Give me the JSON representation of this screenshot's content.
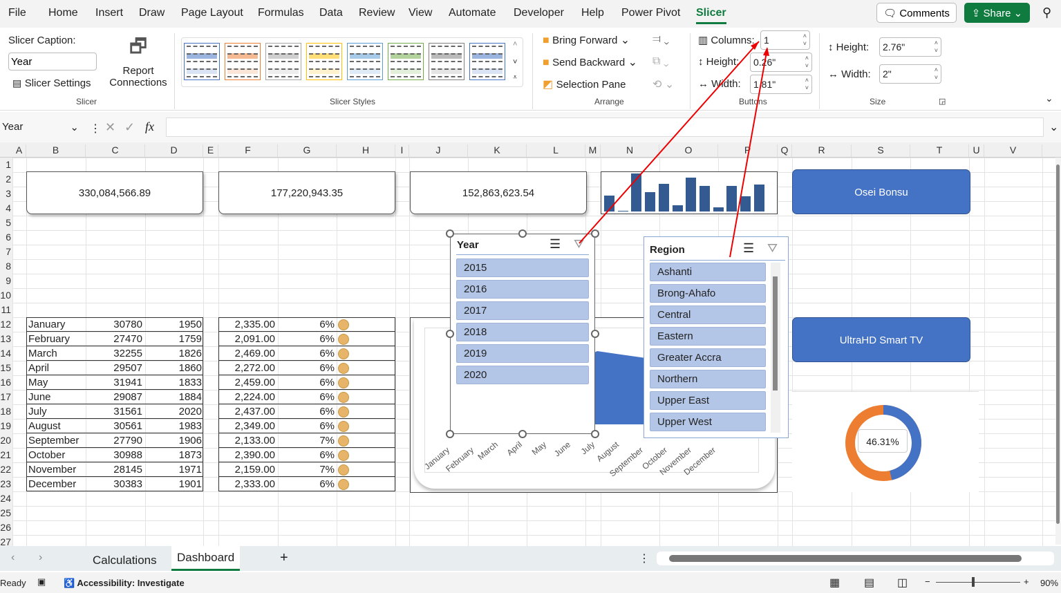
{
  "menu": [
    "File",
    "Home",
    "Insert",
    "Draw",
    "Page Layout",
    "Formulas",
    "Data",
    "Review",
    "View",
    "Automate",
    "Developer",
    "Help",
    "Power Pivot",
    "Slicer"
  ],
  "active_menu": "Slicer",
  "top_buttons": {
    "comments": "Comments",
    "share": "Share"
  },
  "ribbon": {
    "slicer_caption_label": "Slicer Caption:",
    "slicer_caption_value": "Year",
    "slicer_settings": "Slicer Settings",
    "report_connections_1": "Report",
    "report_connections_2": "Connections",
    "group_slicer": "Slicer",
    "group_styles": "Slicer Styles",
    "style_colors": [
      "#4472c4",
      "#ed7d31",
      "#a5a5a5",
      "#ffc000",
      "#5b9bd5",
      "#70ad47",
      "#7f7f7f",
      "#4472c4"
    ],
    "bring_forward": "Bring Forward",
    "send_backward": "Send Backward",
    "selection_pane": "Selection Pane",
    "group_arrange": "Arrange",
    "columns_label": "Columns:",
    "columns_value": "1",
    "btn_height_label": "Height:",
    "btn_height_value": "0.26\"",
    "btn_width_label": "Width:",
    "btn_width_value": "1.81\"",
    "group_buttons": "Buttons",
    "size_height_label": "Height:",
    "size_height_value": "2.76\"",
    "size_width_label": "Width:",
    "size_width_value": "2\"",
    "group_size": "Size"
  },
  "formula_bar": {
    "name_box": "Year",
    "fx": "fx",
    "value": ""
  },
  "columns": [
    "A",
    "B",
    "C",
    "D",
    "E",
    "F",
    "G",
    "H",
    "I",
    "J",
    "K",
    "L",
    "M",
    "N",
    "O",
    "P",
    "Q",
    "R",
    "S",
    "T",
    "U",
    "V"
  ],
  "rows": [
    "1",
    "2",
    "3",
    "4",
    "5",
    "6",
    "7",
    "8",
    "9",
    "10",
    "11",
    "12",
    "13",
    "14",
    "15",
    "16",
    "17",
    "18",
    "19",
    "20",
    "21",
    "22",
    "23",
    "24",
    "25",
    "26",
    "27"
  ],
  "kpis": [
    "330,084,566.89",
    "177,220,943.35",
    "152,863,623.54"
  ],
  "table": [
    [
      "January",
      "30780",
      "1950",
      "2,335.00",
      "6%"
    ],
    [
      "February",
      "27470",
      "1759",
      "2,091.00",
      "6%"
    ],
    [
      "March",
      "32255",
      "1826",
      "2,469.00",
      "6%"
    ],
    [
      "April",
      "29507",
      "1860",
      "2,272.00",
      "6%"
    ],
    [
      "May",
      "31941",
      "1833",
      "2,459.00",
      "6%"
    ],
    [
      "June",
      "29087",
      "1884",
      "2,224.00",
      "6%"
    ],
    [
      "July",
      "31561",
      "2020",
      "2,437.00",
      "6%"
    ],
    [
      "August",
      "30561",
      "1983",
      "2,349.00",
      "6%"
    ],
    [
      "September",
      "27790",
      "1906",
      "2,133.00",
      "7%"
    ],
    [
      "October",
      "30988",
      "1873",
      "2,390.00",
      "6%"
    ],
    [
      "November",
      "28145",
      "1971",
      "2,159.00",
      "7%"
    ],
    [
      "December",
      "30383",
      "1901",
      "2,333.00",
      "6%"
    ]
  ],
  "indicator_color": "#e6b56a",
  "mini_bars": [
    70,
    2,
    167,
    85,
    122,
    27,
    148,
    112,
    19,
    113,
    67,
    118
  ],
  "area_chart_months": [
    "January",
    "February",
    "March",
    "April",
    "May",
    "June",
    "July",
    "August",
    "September",
    "October",
    "November",
    "December"
  ],
  "year_slicer": {
    "title": "Year",
    "items": [
      "2015",
      "2016",
      "2017",
      "2018",
      "2019",
      "2020"
    ]
  },
  "region_slicer": {
    "title": "Region",
    "items": [
      "Ashanti",
      "Brong-Ahafo",
      "Central",
      "Eastern",
      "Greater Accra",
      "Northern",
      "Upper East",
      "Upper West"
    ]
  },
  "name_button": "Osei Bonsu",
  "product_button": "UltraHD Smart TV",
  "donut": {
    "percent": 46.31,
    "label": "46.31%",
    "colors": [
      "#4472c4",
      "#ed7d31"
    ]
  },
  "sheets": [
    "Calculations",
    "Dashboard"
  ],
  "active_sheet": "Dashboard",
  "status": {
    "ready": "Ready",
    "accessibility": "Accessibility: Investigate",
    "zoom": "90%"
  }
}
